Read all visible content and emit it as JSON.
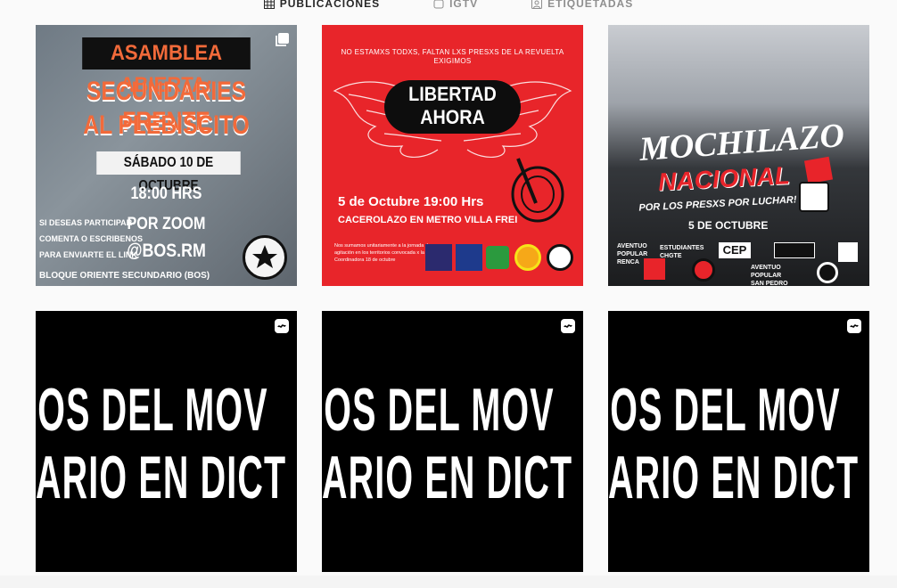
{
  "tabs": [
    {
      "label": "PUBLICACIONES",
      "icon": "grid-icon",
      "active": true
    },
    {
      "label": "IGTV",
      "icon": "igtv-icon",
      "active": false
    },
    {
      "label": "ETIQUETADAS",
      "icon": "tagged-icon",
      "active": false
    }
  ],
  "posts": [
    {
      "badge": "carousel-icon",
      "title1": "ASAMBLEA ABIERTA:",
      "title2": "SECUNDARIES FRENTE",
      "title3": "AL PLEBISCITO",
      "date": "SÁBADO 10 DE OCTUBRE",
      "time": "18:00 HRS",
      "via": "POR ZOOM",
      "handle": "@BOS.RM",
      "side1": "SI DESEAS PARTICIPAR",
      "side2": "COMENTA O ESCRIBENOS",
      "side3": "PARA ENVIARTE EL LINK",
      "footer": "BLOQUE ORIENTE SECUNDARIO (BOS)"
    },
    {
      "top": "NO ESTAMXS TODXS, FALTAN LXS PRESXS DE LA REVUELTA EXIGIMOS",
      "title1": "LIBERTAD",
      "title2": "AHORA",
      "when": "5 de Octubre 19:00 Hrs",
      "where": "CACEROLAZO EN METRO VILLA FREI",
      "note": "Nos sumamos unitariamente a la jornada de agitación en los territorios convocada x la Coordinadora 18 de octubre"
    },
    {
      "title1": "MOCHILAZO",
      "title2": "NACIONAL",
      "title3": "POR LOS PRESXS POR LUCHAR!",
      "date": "5 DE OCTUBRE",
      "org1": "AVENTUO POPULAR RENCA",
      "org2": "ESTUDIANTES CHGTE",
      "org3": "CEP",
      "org4": "AVENTUO POPULAR SAN PEDRO"
    },
    {
      "badge": "reels-icon",
      "line1": "IIOS DEL MOV",
      "line2": "ARIO EN DICT"
    },
    {
      "badge": "reels-icon",
      "line1": "IIOS DEL MOV",
      "line2": "ARIO EN DICT"
    },
    {
      "badge": "reels-icon",
      "line1": "IIOS DEL MOV",
      "line2": "ARIO EN DICT"
    }
  ],
  "colors": {
    "accent_orange": "#f26a3a",
    "post_red": "#e8252a",
    "text_muted": "#8e8e8e"
  }
}
